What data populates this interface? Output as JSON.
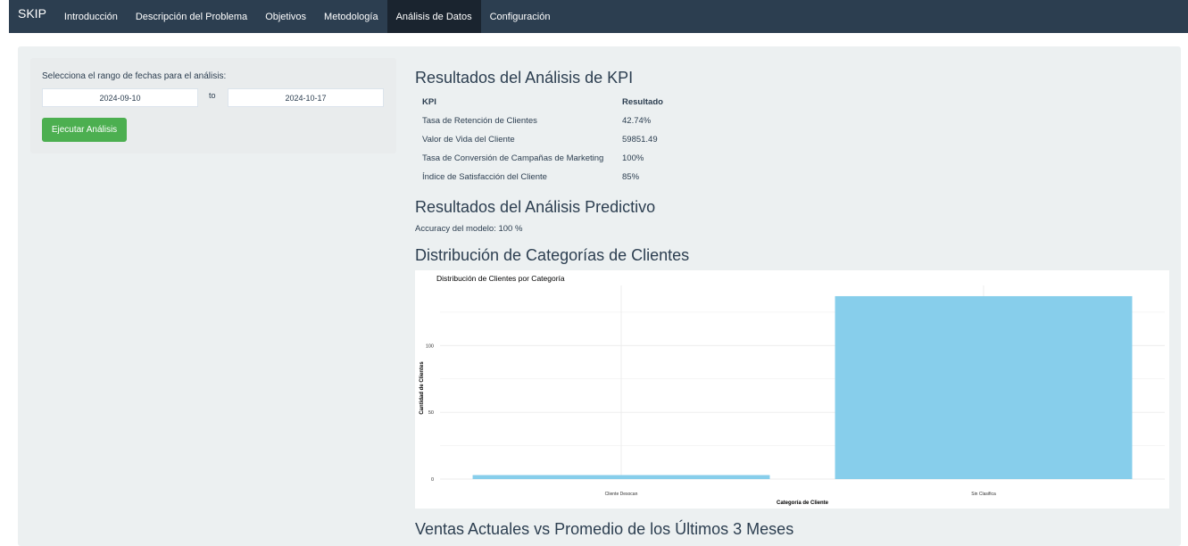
{
  "navbar": {
    "brand": "SKIP",
    "items": [
      {
        "label": "Introducción"
      },
      {
        "label": "Descripción del Problema"
      },
      {
        "label": "Objetivos"
      },
      {
        "label": "Metodología"
      },
      {
        "label": "Análisis de Datos",
        "active": true
      },
      {
        "label": "Configuración"
      }
    ]
  },
  "sidebar": {
    "date_label": "Selecciona el rango de fechas para el análisis:",
    "start_date": "2024-09-10",
    "to_label": "to",
    "end_date": "2024-10-17",
    "run_button": "Ejecutar Análisis"
  },
  "kpi": {
    "title": "Resultados del Análisis de KPI",
    "headers": [
      "KPI",
      "Resultado"
    ],
    "rows": [
      [
        "Tasa de Retención de Clientes",
        "42.74%"
      ],
      [
        "Valor de Vida del Cliente",
        "59851.49"
      ],
      [
        "Tasa de Conversión de Campañas de Marketing",
        "100%"
      ],
      [
        "Índice de Satisfacción del Cliente",
        "85%"
      ]
    ]
  },
  "predictive": {
    "title": "Resultados del Análisis Predictivo",
    "accuracy": "Accuracy del modelo: 100 %"
  },
  "distribution": {
    "title": "Distribución de Categorías de Clientes"
  },
  "sales": {
    "title": "Ventas Actuales vs Promedio de los Últimos 3 Meses"
  },
  "chart_data": {
    "type": "bar",
    "title": "Distribución de Clientes por Categoría",
    "xlabel": "Categoría de Cliente",
    "ylabel": "Cantidad de Clientes",
    "categories": [
      "Cliente Desocan",
      "Sin Clasifica"
    ],
    "values": [
      3,
      137
    ],
    "ylim": [
      0,
      145
    ],
    "yticks": [
      0,
      50,
      100
    ],
    "bar_color": "#87ceeb",
    "grid": true
  }
}
